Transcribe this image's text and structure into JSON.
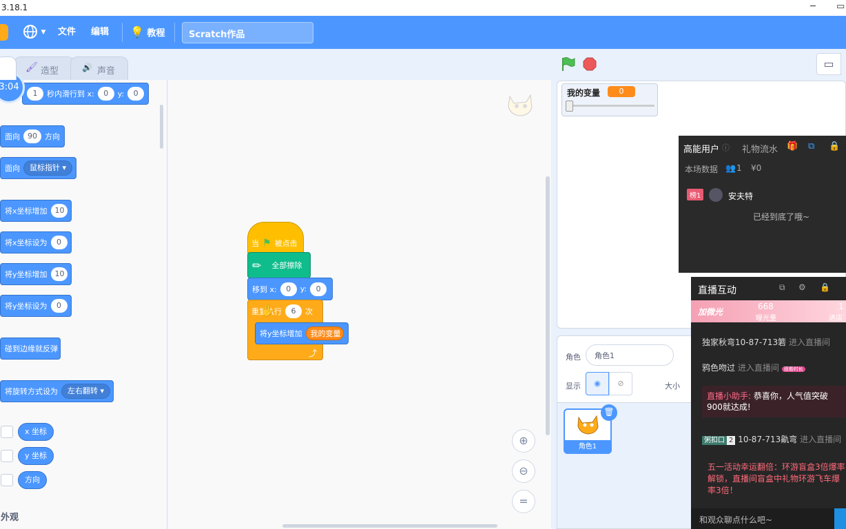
{
  "titlebar": {
    "version": "3.18.1",
    "min": "─",
    "restore": "▭"
  },
  "menubar": {
    "file": "文件",
    "edit": "编辑",
    "tutorial": "教程",
    "project_title": "Scratch作品"
  },
  "tabs": {
    "costumes": "造型",
    "sounds": "声音"
  },
  "timer": "3:04",
  "palette": {
    "glide": {
      "secs": "1",
      "text": "秒内滑行到 x:",
      "x": "0",
      "y_label": "y:",
      "y": "0"
    },
    "point_dir": {
      "label": "面向",
      "value": "90",
      "suffix": "方向"
    },
    "point_towards": {
      "label": "面向",
      "value": "鼠标指针"
    },
    "change_x": {
      "label": "将x坐标增加",
      "value": "10"
    },
    "set_x": {
      "label": "将x坐标设为",
      "value": "0"
    },
    "change_y": {
      "label": "将y坐标增加",
      "value": "10"
    },
    "set_y": {
      "label": "将y坐标设为",
      "value": "0"
    },
    "bounce": "碰到边缘就反弹",
    "rotation": {
      "label": "将旋转方式设为",
      "value": "左右翻转"
    },
    "rep_x": "x 坐标",
    "rep_y": "y 坐标",
    "rep_dir": "方向",
    "category_looks": "外观"
  },
  "script": {
    "hat_when": "当",
    "hat_clicked": "被点击",
    "clear": "全部擦除",
    "goto_label": "移到 x:",
    "goto_x": "0",
    "goto_y_label": "y:",
    "goto_y": "0",
    "repeat_label": "重复执行",
    "repeat_count": "6",
    "repeat_suffix": "次",
    "change_y_label": "将y坐标增加",
    "change_y_var": "我的变量"
  },
  "stage": {
    "var_name": "我的变量",
    "var_value": "0"
  },
  "sprite_info": {
    "sprite_label": "角色",
    "sprite_name": "角色1",
    "show_label": "显示",
    "size_label": "大小"
  },
  "sprite_list": {
    "sprite1": "角色1"
  },
  "gift_panel": {
    "tab_users": "高能用户",
    "tab_gifts": "礼物流水",
    "stats_label": "本场数据",
    "stats_users": "1",
    "stats_money": "¥0",
    "rank_badge": "榜1",
    "user_name": "安夫特",
    "end_msg": "已经到底了哦~"
  },
  "live_panel": {
    "title": "直播互动",
    "banner_left": "加微光",
    "banner_count": "668",
    "banner_count_label": "曝光量",
    "banner_right_num": "1",
    "banner_right_label": "进店",
    "msg1_user": "独家秋弯10-87-713箬",
    "msg1_action": "进入直播间",
    "msg2_user": "鸦色吻过",
    "msg2_action": "进入直播间",
    "msg2_tag": "观看时长",
    "assistant_name": "直播小助手:",
    "assistant_msg": "恭喜你，人气值突破900就达成!",
    "msg3_tag": "粥扣口",
    "msg3_level": "2",
    "msg3_user": "10-87-713鼽弯",
    "msg3_action": "进入直播间",
    "promo": "五一活动幸运翻倍：环游盲盒3倍爆率解锁，直播间盲盒中礼物环游飞车爆率3倍！",
    "input_placeholder": "和观众聊点什么吧~"
  },
  "colors": {
    "menubar": "#4c97ff",
    "motion": "#4c97ff",
    "events": "#ffbf00",
    "pen": "#0fbd8c",
    "control": "#ffab19",
    "variables": "#ff8c1a"
  }
}
